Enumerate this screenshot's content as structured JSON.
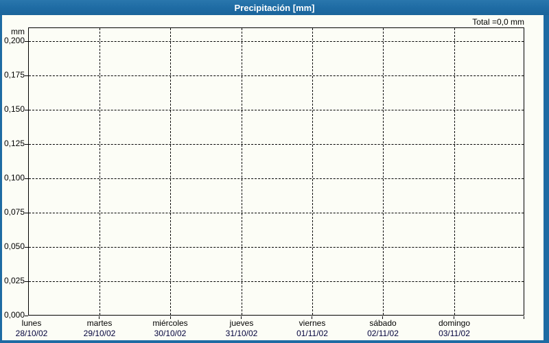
{
  "window": {
    "title": "Precipitación [mm]",
    "frame_color": "#1e6ba3"
  },
  "summary": {
    "total_label": "Total =0,0 mm"
  },
  "chart_data": {
    "type": "bar",
    "title": "Precipitación [mm]",
    "ylabel": "mm",
    "total_text": "Total =0,0 mm",
    "total_value_mm": 0.0,
    "ylim": [
      0,
      0.21
    ],
    "y_tick_step": 0.025,
    "y_ticks": [
      "0,200",
      "0,175",
      "0,150",
      "0,125",
      "0,100",
      "0,075",
      "0,050",
      "0,025",
      "0,000"
    ],
    "grid": "dashed horizontal lines at each y tick; dashed vertical separators between days",
    "legend_position": "none",
    "days": [
      {
        "name": "lunes",
        "date": "28/10/02",
        "value": 0
      },
      {
        "name": "martes",
        "date": "29/10/02",
        "value": 0
      },
      {
        "name": "miércoles",
        "date": "30/10/02",
        "value": 0
      },
      {
        "name": "jueves",
        "date": "31/10/02",
        "value": 0
      },
      {
        "name": "viernes",
        "date": "01/11/02",
        "value": 0
      },
      {
        "name": "sábado",
        "date": "02/11/02",
        "value": 0
      },
      {
        "name": "domingo",
        "date": "03/11/02",
        "value": 0
      }
    ],
    "values": [
      0,
      0,
      0,
      0,
      0,
      0,
      0
    ]
  }
}
